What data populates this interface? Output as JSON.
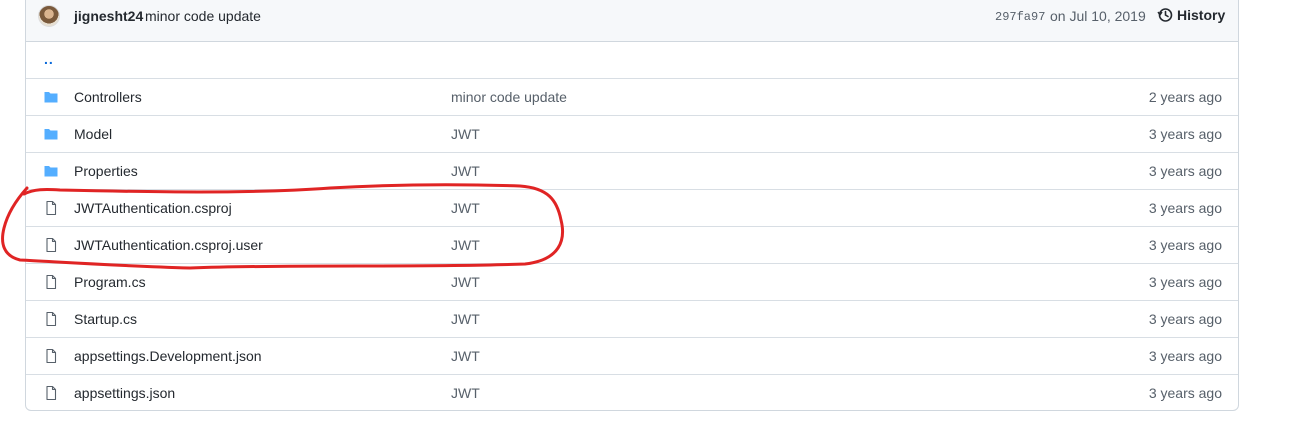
{
  "commit": {
    "author": "jignesht24",
    "message": "minor code update",
    "sha": "297fa97",
    "date": "on Jul 10, 2019",
    "history_label": "History"
  },
  "up_link": "..",
  "files": [
    {
      "type": "folder",
      "icon": "folder-icon",
      "name": "Controllers",
      "commit": "minor code update",
      "age": "2 years ago"
    },
    {
      "type": "folder",
      "icon": "folder-icon",
      "name": "Model",
      "commit": "JWT",
      "age": "3 years ago"
    },
    {
      "type": "folder",
      "icon": "folder-icon",
      "name": "Properties",
      "commit": "JWT",
      "age": "3 years ago"
    },
    {
      "type": "file",
      "icon": "file-icon",
      "name": "JWTAuthentication.csproj",
      "commit": "JWT",
      "age": "3 years ago"
    },
    {
      "type": "file",
      "icon": "file-icon",
      "name": "JWTAuthentication.csproj.user",
      "commit": "JWT",
      "age": "3 years ago"
    },
    {
      "type": "file",
      "icon": "file-icon",
      "name": "Program.cs",
      "commit": "JWT",
      "age": "3 years ago"
    },
    {
      "type": "file",
      "icon": "file-icon",
      "name": "Startup.cs",
      "commit": "JWT",
      "age": "3 years ago"
    },
    {
      "type": "file",
      "icon": "file-icon",
      "name": "appsettings.Development.json",
      "commit": "JWT",
      "age": "3 years ago"
    },
    {
      "type": "file",
      "icon": "file-icon",
      "name": "appsettings.json",
      "commit": "JWT",
      "age": "3 years ago"
    }
  ],
  "colors": {
    "folder": "#54aeff",
    "file_icon": "#57606a",
    "annotation": "#e02424",
    "link": "#0969da"
  }
}
